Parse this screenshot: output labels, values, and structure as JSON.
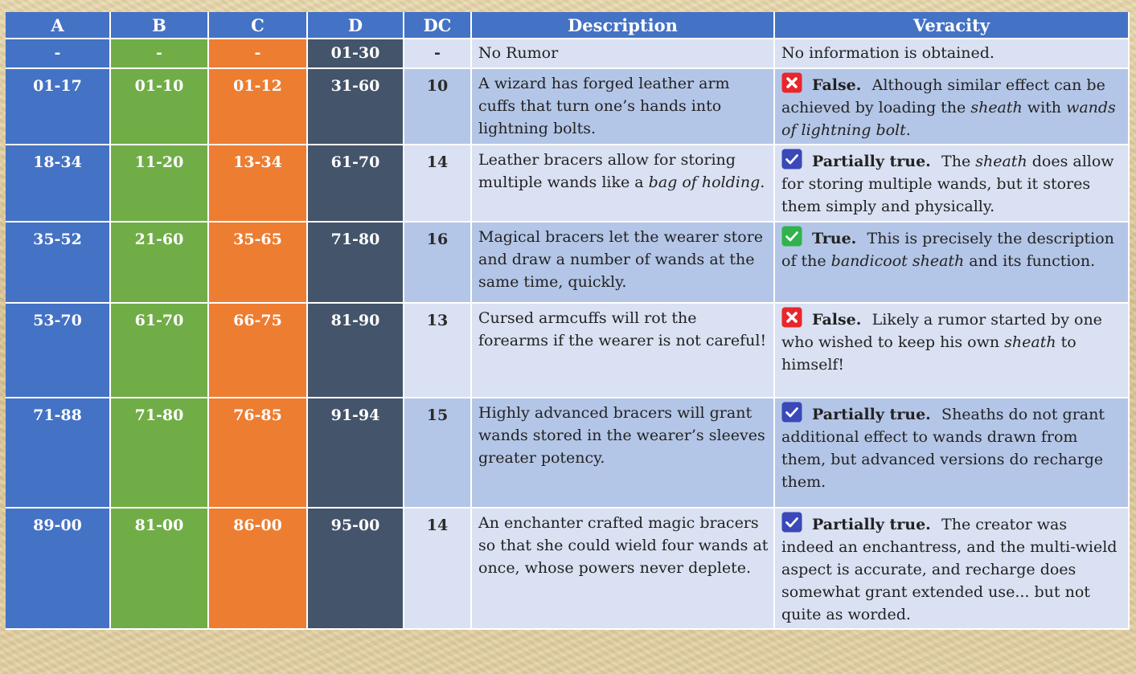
{
  "headers": [
    "A",
    "B",
    "C",
    "D",
    "DC",
    "Description",
    "Veracity"
  ],
  "rows": [
    {
      "a": "-",
      "b": "-",
      "c": "-",
      "d": "01-30",
      "dc": "-",
      "description": [
        {
          "t": "No Rumor"
        }
      ],
      "verdict_icon": null,
      "verdict": "",
      "veracity": [
        {
          "t": "No information is obtained."
        }
      ]
    },
    {
      "a": "01-17",
      "b": "01-10",
      "c": "01-12",
      "d": "31-60",
      "dc": "10",
      "description": [
        {
          "t": "A wizard has forged leather arm cuffs that turn one’s hands into lightning bolts."
        }
      ],
      "verdict_icon": "false-x-icon",
      "verdict": "False.",
      "veracity": [
        {
          "t": "Although similar effect can be achieved by loading the "
        },
        {
          "t": "sheath",
          "i": true
        },
        {
          "t": " with "
        },
        {
          "t": "wands of lightning bolt",
          "i": true
        },
        {
          "t": "."
        }
      ]
    },
    {
      "a": "18-34",
      "b": "11-20",
      "c": "13-34",
      "d": "61-70",
      "dc": "14",
      "description": [
        {
          "t": "Leather bracers allow for storing multiple wands like a "
        },
        {
          "t": "bag of holding",
          "i": true
        },
        {
          "t": "."
        }
      ],
      "verdict_icon": "partial-check-icon",
      "verdict": "Partially true.",
      "veracity": [
        {
          "t": "The "
        },
        {
          "t": "sheath",
          "i": true
        },
        {
          "t": " does allow for storing multiple wands, but it stores them simply and physically."
        }
      ]
    },
    {
      "a": "35-52",
      "b": "21-60",
      "c": "35-65",
      "d": "71-80",
      "dc": "16",
      "description": [
        {
          "t": "Magical bracers let the wearer store and draw a number of wands at the same time, quickly."
        }
      ],
      "verdict_icon": "true-check-icon",
      "verdict": "True.",
      "veracity": [
        {
          "t": "This is precisely the description of the "
        },
        {
          "t": "bandicoot sheath",
          "i": true
        },
        {
          "t": " and its function."
        }
      ]
    },
    {
      "a": "53-70",
      "b": "61-70",
      "c": "66-75",
      "d": "81-90",
      "dc": "13",
      "description": [
        {
          "t": "Cursed armcuffs will rot the forearms if the wearer is not careful!"
        }
      ],
      "verdict_icon": "false-x-icon",
      "verdict": "False.",
      "veracity": [
        {
          "t": "Likely a rumor started by one who wished to keep his own "
        },
        {
          "t": "sheath",
          "i": true
        },
        {
          "t": " to himself!"
        }
      ]
    },
    {
      "a": "71-88",
      "b": "71-80",
      "c": "76-85",
      "d": "91-94",
      "dc": "15",
      "description": [
        {
          "t": "Highly advanced bracers will grant wands stored in the wearer’s sleeves greater potency."
        }
      ],
      "verdict_icon": "partial-check-icon",
      "verdict": "Partially true.",
      "veracity": [
        {
          "t": "Sheaths do not grant additional effect to wands drawn from them, but advanced versions do recharge them."
        }
      ]
    },
    {
      "a": "89-00",
      "b": "81-00",
      "c": "86-00",
      "d": "95-00",
      "dc": "14",
      "description": [
        {
          "t": "An enchanter crafted magic bracers so that she could wield four wands at once, whose powers never deplete."
        }
      ],
      "verdict_icon": "partial-check-icon",
      "verdict": "Partially true.",
      "veracity": [
        {
          "t": "The creator was indeed an enchantress, and the multi-wield aspect is accurate, and recharge does somewhat grant extended use... but not quite as worded."
        }
      ]
    }
  ],
  "icons": {
    "false-x-icon": {
      "bg": "#e8262b",
      "fg": "#ffffff"
    },
    "partial-check-icon": {
      "bg": "#3a48b8",
      "fg": "#ffffff"
    },
    "true-check-icon": {
      "bg": "#2fb34a",
      "fg": "#ffffff"
    }
  },
  "colors": {
    "col_a": "#4472c4",
    "col_b": "#70ad47",
    "col_c": "#ed7d31",
    "col_d": "#44546a",
    "row_light": "#d9e1f2",
    "row_dark": "#b4c6e7",
    "header": "#4472c4"
  }
}
